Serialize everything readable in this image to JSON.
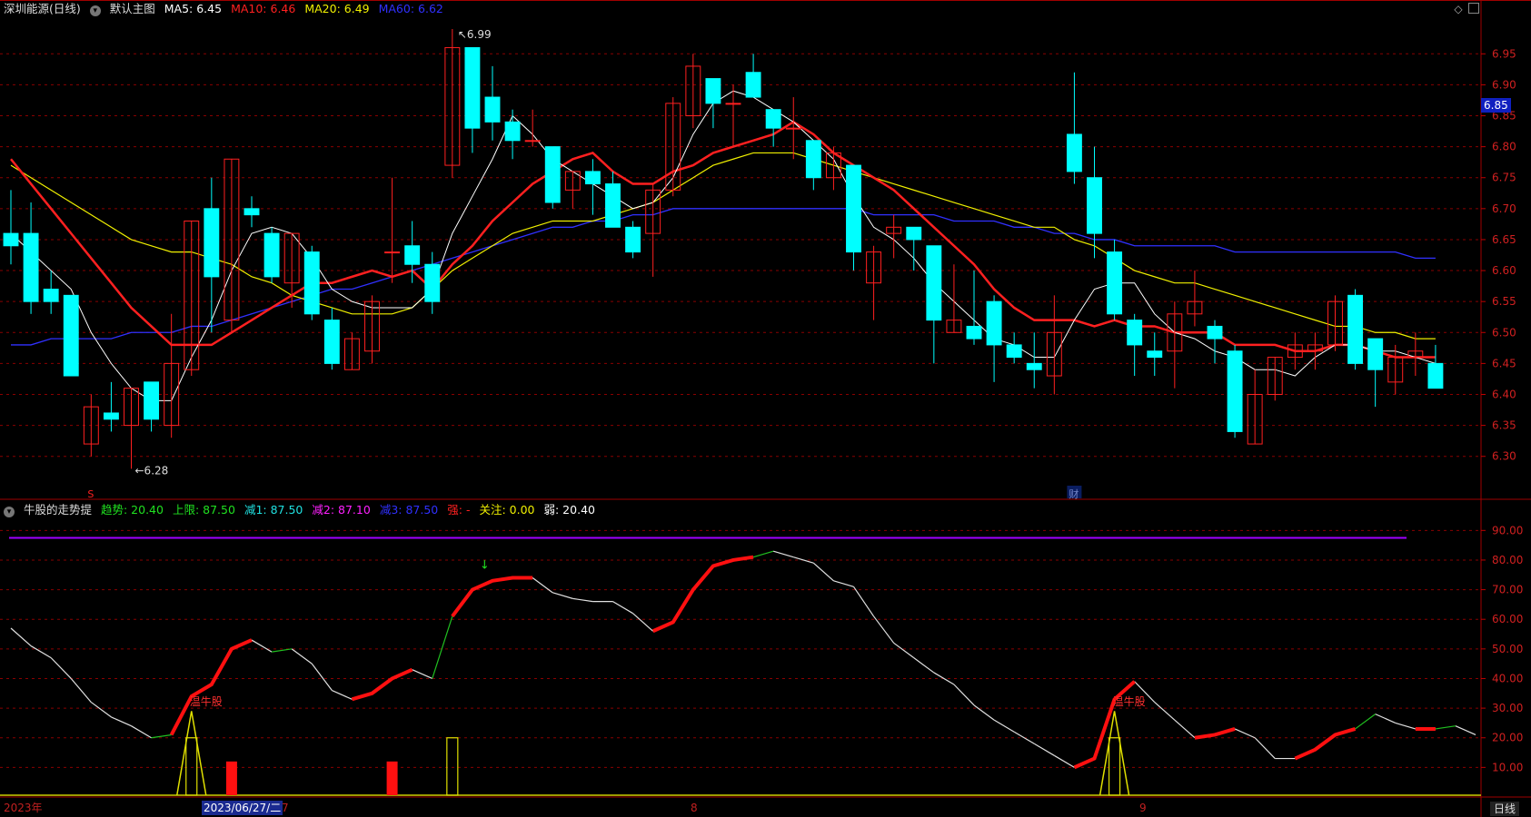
{
  "main_header": {
    "title": "深圳能源(日线)",
    "template_label": "默认主图",
    "ma5": {
      "label": "MA5:",
      "value": "6.45",
      "color": "#ffffff"
    },
    "ma10": {
      "label": "MA10:",
      "value": "6.46",
      "color": "#ff2020"
    },
    "ma20": {
      "label": "MA20:",
      "value": "6.49",
      "color": "#f0f000"
    },
    "ma60": {
      "label": "MA60:",
      "value": "6.62",
      "color": "#3030ff"
    }
  },
  "price_axis": {
    "ticks": [
      "6.95",
      "6.90",
      "6.85",
      "6.80",
      "6.75",
      "6.70",
      "6.65",
      "6.60",
      "6.55",
      "6.50",
      "6.45",
      "6.40",
      "6.35",
      "6.30"
    ],
    "current_price": "6.85"
  },
  "annotations": {
    "high_label": "6.99",
    "low_label": "6.28",
    "s_marker": "S",
    "cai_marker": "财"
  },
  "indicator_header": {
    "name": "牛股的走势提",
    "items": [
      {
        "label": "趋势:",
        "value": "20.40",
        "color": "#20e020"
      },
      {
        "label": "上限:",
        "value": "87.50",
        "color": "#20e020"
      },
      {
        "label": "减1:",
        "value": "87.50",
        "color": "#20e0e0"
      },
      {
        "label": "减2:",
        "value": "87.10",
        "color": "#ff20ff"
      },
      {
        "label": "减3:",
        "value": "87.50",
        "color": "#3030ff"
      },
      {
        "label": "强:",
        "value": "-",
        "color": "#ff2020"
      },
      {
        "label": "关注:",
        "value": "0.00",
        "color": "#f0f000"
      },
      {
        "label": "弱:",
        "value": "20.40",
        "color": "#ffffff"
      }
    ]
  },
  "indicator_axis": {
    "ticks": [
      "90.00",
      "80.00",
      "70.00",
      "60.00",
      "50.00",
      "40.00",
      "30.00",
      "20.00",
      "10.00"
    ]
  },
  "indicator_labels": {
    "bull_stock_1": "温牛股",
    "bull_stock_2": "温牛股"
  },
  "time_axis": {
    "year_label": "2023年",
    "cursor_date": "2023/06/27/二",
    "after_cursor": "7",
    "month_8": "8",
    "month_9": "9",
    "period": "日线"
  },
  "colors": {
    "up": "#ff2020",
    "down": "#00ffff",
    "ma5": "#ffffff",
    "ma10": "#ff2020",
    "ma20": "#f0f000",
    "ma60": "#3030ff",
    "grid": "#8a0000",
    "upper_line": "#a000ff"
  },
  "chart_data": {
    "type": "candlestick",
    "candles": [
      {
        "o": 6.66,
        "h": 6.73,
        "l": 6.61,
        "c": 6.64
      },
      {
        "o": 6.66,
        "h": 6.71,
        "l": 6.53,
        "c": 6.55
      },
      {
        "o": 6.57,
        "h": 6.6,
        "l": 6.53,
        "c": 6.55
      },
      {
        "o": 6.56,
        "h": 6.56,
        "l": 6.43,
        "c": 6.43
      },
      {
        "o": 6.32,
        "h": 6.4,
        "l": 6.3,
        "c": 6.38
      },
      {
        "o": 6.37,
        "h": 6.42,
        "l": 6.34,
        "c": 6.36
      },
      {
        "o": 6.35,
        "h": 6.41,
        "l": 6.28,
        "c": 6.41
      },
      {
        "o": 6.42,
        "h": 6.42,
        "l": 6.34,
        "c": 6.36
      },
      {
        "o": 6.35,
        "h": 6.53,
        "l": 6.33,
        "c": 6.45
      },
      {
        "o": 6.44,
        "h": 6.68,
        "l": 6.43,
        "c": 6.68
      },
      {
        "o": 6.7,
        "h": 6.75,
        "l": 6.5,
        "c": 6.59
      },
      {
        "o": 6.52,
        "h": 6.78,
        "l": 6.5,
        "c": 6.78
      },
      {
        "o": 6.7,
        "h": 6.72,
        "l": 6.67,
        "c": 6.69
      },
      {
        "o": 6.66,
        "h": 6.67,
        "l": 6.58,
        "c": 6.59
      },
      {
        "o": 6.58,
        "h": 6.66,
        "l": 6.54,
        "c": 6.66
      },
      {
        "o": 6.63,
        "h": 6.64,
        "l": 6.52,
        "c": 6.53
      },
      {
        "o": 6.52,
        "h": 6.54,
        "l": 6.44,
        "c": 6.45
      },
      {
        "o": 6.44,
        "h": 6.5,
        "l": 6.44,
        "c": 6.49
      },
      {
        "o": 6.47,
        "h": 6.56,
        "l": 6.45,
        "c": 6.55
      },
      {
        "o": 6.63,
        "h": 6.75,
        "l": 6.58,
        "c": 6.63
      },
      {
        "o": 6.64,
        "h": 6.68,
        "l": 6.58,
        "c": 6.61
      },
      {
        "o": 6.61,
        "h": 6.63,
        "l": 6.53,
        "c": 6.55
      },
      {
        "o": 6.77,
        "h": 6.99,
        "l": 6.75,
        "c": 6.96
      },
      {
        "o": 6.96,
        "h": 6.96,
        "l": 6.79,
        "c": 6.83
      },
      {
        "o": 6.88,
        "h": 6.93,
        "l": 6.81,
        "c": 6.84
      },
      {
        "o": 6.84,
        "h": 6.86,
        "l": 6.78,
        "c": 6.81
      },
      {
        "o": 6.81,
        "h": 6.86,
        "l": 6.8,
        "c": 6.81
      },
      {
        "o": 6.8,
        "h": 6.8,
        "l": 6.7,
        "c": 6.71
      },
      {
        "o": 6.73,
        "h": 6.76,
        "l": 6.7,
        "c": 6.76
      },
      {
        "o": 6.76,
        "h": 6.78,
        "l": 6.69,
        "c": 6.74
      },
      {
        "o": 6.74,
        "h": 6.76,
        "l": 6.67,
        "c": 6.67
      },
      {
        "o": 6.67,
        "h": 6.68,
        "l": 6.62,
        "c": 6.63
      },
      {
        "o": 6.66,
        "h": 6.74,
        "l": 6.59,
        "c": 6.73
      },
      {
        "o": 6.73,
        "h": 6.88,
        "l": 6.72,
        "c": 6.87
      },
      {
        "o": 6.85,
        "h": 6.95,
        "l": 6.83,
        "c": 6.93
      },
      {
        "o": 6.91,
        "h": 6.91,
        "l": 6.83,
        "c": 6.87
      },
      {
        "o": 6.87,
        "h": 6.9,
        "l": 6.8,
        "c": 6.87
      },
      {
        "o": 6.92,
        "h": 6.95,
        "l": 6.88,
        "c": 6.88
      },
      {
        "o": 6.86,
        "h": 6.86,
        "l": 6.8,
        "c": 6.83
      },
      {
        "o": 6.83,
        "h": 6.88,
        "l": 6.78,
        "c": 6.83
      },
      {
        "o": 6.81,
        "h": 6.81,
        "l": 6.73,
        "c": 6.75
      },
      {
        "o": 6.75,
        "h": 6.8,
        "l": 6.73,
        "c": 6.79
      },
      {
        "o": 6.77,
        "h": 6.77,
        "l": 6.6,
        "c": 6.63
      },
      {
        "o": 6.58,
        "h": 6.64,
        "l": 6.52,
        "c": 6.63
      },
      {
        "o": 6.66,
        "h": 6.69,
        "l": 6.62,
        "c": 6.67
      },
      {
        "o": 6.67,
        "h": 6.67,
        "l": 6.6,
        "c": 6.65
      },
      {
        "o": 6.64,
        "h": 6.64,
        "l": 6.45,
        "c": 6.52
      },
      {
        "o": 6.5,
        "h": 6.61,
        "l": 6.5,
        "c": 6.52
      },
      {
        "o": 6.51,
        "h": 6.6,
        "l": 6.48,
        "c": 6.49
      },
      {
        "o": 6.55,
        "h": 6.56,
        "l": 6.42,
        "c": 6.48
      },
      {
        "o": 6.48,
        "h": 6.5,
        "l": 6.45,
        "c": 6.46
      },
      {
        "o": 6.45,
        "h": 6.5,
        "l": 6.41,
        "c": 6.44
      },
      {
        "o": 6.43,
        "h": 6.56,
        "l": 6.4,
        "c": 6.5
      },
      {
        "o": 6.82,
        "h": 6.92,
        "l": 6.74,
        "c": 6.76
      },
      {
        "o": 6.75,
        "h": 6.8,
        "l": 6.62,
        "c": 6.66
      },
      {
        "o": 6.63,
        "h": 6.65,
        "l": 6.52,
        "c": 6.53
      },
      {
        "o": 6.52,
        "h": 6.53,
        "l": 6.43,
        "c": 6.48
      },
      {
        "o": 6.47,
        "h": 6.5,
        "l": 6.43,
        "c": 6.46
      },
      {
        "o": 6.47,
        "h": 6.55,
        "l": 6.41,
        "c": 6.53
      },
      {
        "o": 6.53,
        "h": 6.6,
        "l": 6.51,
        "c": 6.55
      },
      {
        "o": 6.51,
        "h": 6.52,
        "l": 6.45,
        "c": 6.49
      },
      {
        "o": 6.47,
        "h": 6.48,
        "l": 6.33,
        "c": 6.34
      },
      {
        "o": 6.32,
        "h": 6.44,
        "l": 6.32,
        "c": 6.4
      },
      {
        "o": 6.4,
        "h": 6.46,
        "l": 6.39,
        "c": 6.46
      },
      {
        "o": 6.46,
        "h": 6.5,
        "l": 6.44,
        "c": 6.48
      },
      {
        "o": 6.47,
        "h": 6.5,
        "l": 6.44,
        "c": 6.48
      },
      {
        "o": 6.48,
        "h": 6.56,
        "l": 6.47,
        "c": 6.55
      },
      {
        "o": 6.56,
        "h": 6.57,
        "l": 6.44,
        "c": 6.45
      },
      {
        "o": 6.49,
        "h": 6.49,
        "l": 6.38,
        "c": 6.44
      },
      {
        "o": 6.42,
        "h": 6.48,
        "l": 6.4,
        "c": 6.46
      },
      {
        "o": 6.46,
        "h": 6.5,
        "l": 6.43,
        "c": 6.47
      },
      {
        "o": 6.45,
        "h": 6.48,
        "l": 6.41,
        "c": 6.41
      }
    ],
    "ma5": [
      6.66,
      6.63,
      6.6,
      6.57,
      6.5,
      6.45,
      6.41,
      6.39,
      6.39,
      6.46,
      6.52,
      6.6,
      6.66,
      6.67,
      6.66,
      6.62,
      6.57,
      6.55,
      6.54,
      6.54,
      6.54,
      6.57,
      6.66,
      6.72,
      6.78,
      6.85,
      6.82,
      6.78,
      6.76,
      6.74,
      6.72,
      6.7,
      6.71,
      6.75,
      6.82,
      6.87,
      6.89,
      6.88,
      6.86,
      6.84,
      6.81,
      6.78,
      6.72,
      6.67,
      6.65,
      6.62,
      6.58,
      6.55,
      6.52,
      6.49,
      6.48,
      6.46,
      6.46,
      6.52,
      6.57,
      6.58,
      6.58,
      6.53,
      6.5,
      6.49,
      6.47,
      6.46,
      6.44,
      6.44,
      6.43,
      6.46,
      6.48,
      6.48,
      6.47,
      6.47,
      6.46,
      6.45
    ],
    "ma10": [
      6.78,
      6.74,
      6.7,
      6.66,
      6.62,
      6.58,
      6.54,
      6.51,
      6.48,
      6.48,
      6.48,
      6.5,
      6.52,
      6.54,
      6.56,
      6.58,
      6.58,
      6.59,
      6.6,
      6.59,
      6.6,
      6.57,
      6.61,
      6.64,
      6.68,
      6.71,
      6.74,
      6.76,
      6.78,
      6.79,
      6.76,
      6.74,
      6.74,
      6.76,
      6.77,
      6.79,
      6.8,
      6.81,
      6.82,
      6.84,
      6.82,
      6.79,
      6.77,
      6.75,
      6.73,
      6.7,
      6.67,
      6.64,
      6.61,
      6.57,
      6.54,
      6.52,
      6.52,
      6.52,
      6.51,
      6.52,
      6.51,
      6.51,
      6.5,
      6.5,
      6.5,
      6.48,
      6.48,
      6.48,
      6.47,
      6.47,
      6.48,
      6.48,
      6.47,
      6.46,
      6.46,
      6.46
    ],
    "ma20": [
      6.77,
      6.75,
      6.73,
      6.71,
      6.69,
      6.67,
      6.65,
      6.64,
      6.63,
      6.63,
      6.62,
      6.61,
      6.59,
      6.58,
      6.56,
      6.55,
      6.54,
      6.53,
      6.53,
      6.53,
      6.54,
      6.57,
      6.6,
      6.62,
      6.64,
      6.66,
      6.67,
      6.68,
      6.68,
      6.68,
      6.69,
      6.7,
      6.71,
      6.73,
      6.75,
      6.77,
      6.78,
      6.79,
      6.79,
      6.79,
      6.78,
      6.77,
      6.76,
      6.75,
      6.74,
      6.73,
      6.72,
      6.71,
      6.7,
      6.69,
      6.68,
      6.67,
      6.67,
      6.65,
      6.64,
      6.62,
      6.6,
      6.59,
      6.58,
      6.58,
      6.57,
      6.56,
      6.55,
      6.54,
      6.53,
      6.52,
      6.51,
      6.51,
      6.5,
      6.5,
      6.49,
      6.49
    ],
    "ma60": [
      6.48,
      6.48,
      6.49,
      6.49,
      6.49,
      6.49,
      6.5,
      6.5,
      6.5,
      6.51,
      6.51,
      6.52,
      6.53,
      6.54,
      6.55,
      6.56,
      6.57,
      6.57,
      6.58,
      6.59,
      6.6,
      6.61,
      6.62,
      6.63,
      6.64,
      6.65,
      6.66,
      6.67,
      6.67,
      6.68,
      6.68,
      6.69,
      6.69,
      6.7,
      6.7,
      6.7,
      6.7,
      6.7,
      6.7,
      6.7,
      6.7,
      6.7,
      6.7,
      6.69,
      6.69,
      6.69,
      6.69,
      6.68,
      6.68,
      6.68,
      6.67,
      6.67,
      6.66,
      6.66,
      6.65,
      6.65,
      6.64,
      6.64,
      6.64,
      6.64,
      6.64,
      6.63,
      6.63,
      6.63,
      6.63,
      6.63,
      6.63,
      6.63,
      6.63,
      6.63,
      6.62,
      6.62
    ],
    "trend": [
      57,
      51,
      47,
      40,
      32,
      27,
      24,
      20,
      21,
      34,
      38,
      50,
      53,
      49,
      50,
      45,
      36,
      33,
      35,
      40,
      43,
      40,
      61,
      70,
      73,
      74,
      74,
      69,
      67,
      66,
      66,
      62,
      56,
      59,
      70,
      78,
      80,
      81,
      83,
      81,
      79,
      73,
      71,
      61,
      52,
      47,
      42,
      38,
      31,
      26,
      22,
      18,
      14,
      10,
      13,
      33,
      39,
      32,
      26,
      20,
      21,
      23,
      20,
      13,
      13,
      16,
      21,
      23,
      28,
      25,
      23,
      23,
      24,
      21
    ],
    "trend_strong_ranges": [
      [
        8,
        12
      ],
      [
        17,
        20
      ],
      [
        22,
        26
      ],
      [
        32,
        37
      ],
      [
        53,
        56
      ],
      [
        59,
        61
      ],
      [
        64,
        67
      ],
      [
        70,
        71
      ]
    ],
    "upper_limit": 87.5,
    "bull_spikes": [
      {
        "index": 9,
        "value": 29
      },
      {
        "index": 55,
        "value": 29
      }
    ],
    "yellow_bars": [
      {
        "index": 9,
        "value": 20
      },
      {
        "index": 22,
        "value": 20
      },
      {
        "index": 55,
        "value": 20
      }
    ],
    "red_bars": [
      {
        "index": 11,
        "value": 12
      },
      {
        "index": 19,
        "value": 12
      }
    ],
    "ylim_price": [
      6.26,
      6.99
    ],
    "ylim_indicator": [
      0,
      95
    ]
  }
}
